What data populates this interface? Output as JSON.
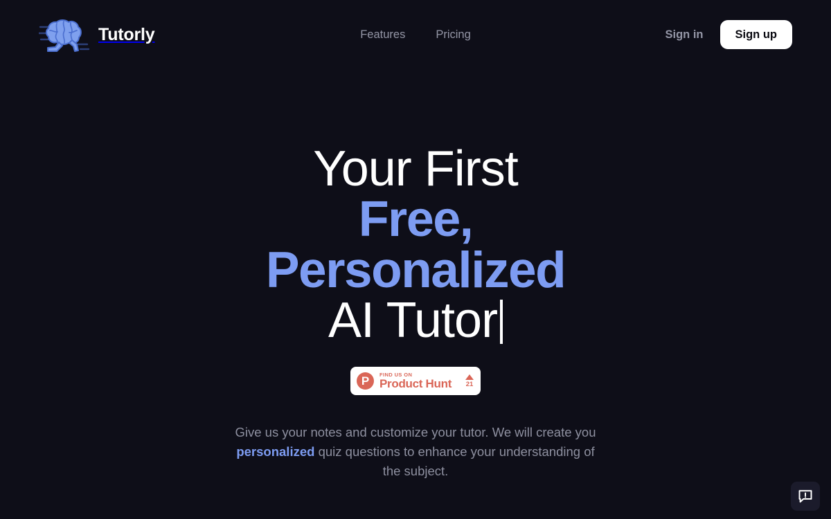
{
  "theme": {
    "background": "#0e0e18",
    "accent_blue": "#7d9cf2",
    "muted_text": "#9496a6",
    "product_hunt_orange": "#da6657"
  },
  "header": {
    "brand": {
      "name": "Tutorly",
      "logo_icon": "running-brain-logo"
    },
    "nav_links": [
      {
        "label": "Features"
      },
      {
        "label": "Pricing"
      }
    ],
    "sign_in_label": "Sign in",
    "sign_up_label": "Sign up"
  },
  "hero": {
    "headline_lines": [
      {
        "text": "Your First",
        "style": "plain"
      },
      {
        "text": "Free,",
        "style": "accent"
      },
      {
        "text": "Personalized",
        "style": "accent"
      },
      {
        "text": "AI Tutor",
        "style": "plain-caret"
      }
    ],
    "product_hunt": {
      "mark_letter": "P",
      "kicker": "FIND US ON",
      "title": "Product Hunt",
      "upvote_count": "21",
      "arrow_icon": "triangle-up-icon"
    },
    "subtitle": {
      "part1": "Give us your notes and customize your tutor. We will create you ",
      "highlight": "personalized",
      "part2": " quiz questions to enhance your understanding of the subject."
    }
  },
  "feedback": {
    "icon": "feedback-speech-bubble-icon"
  }
}
